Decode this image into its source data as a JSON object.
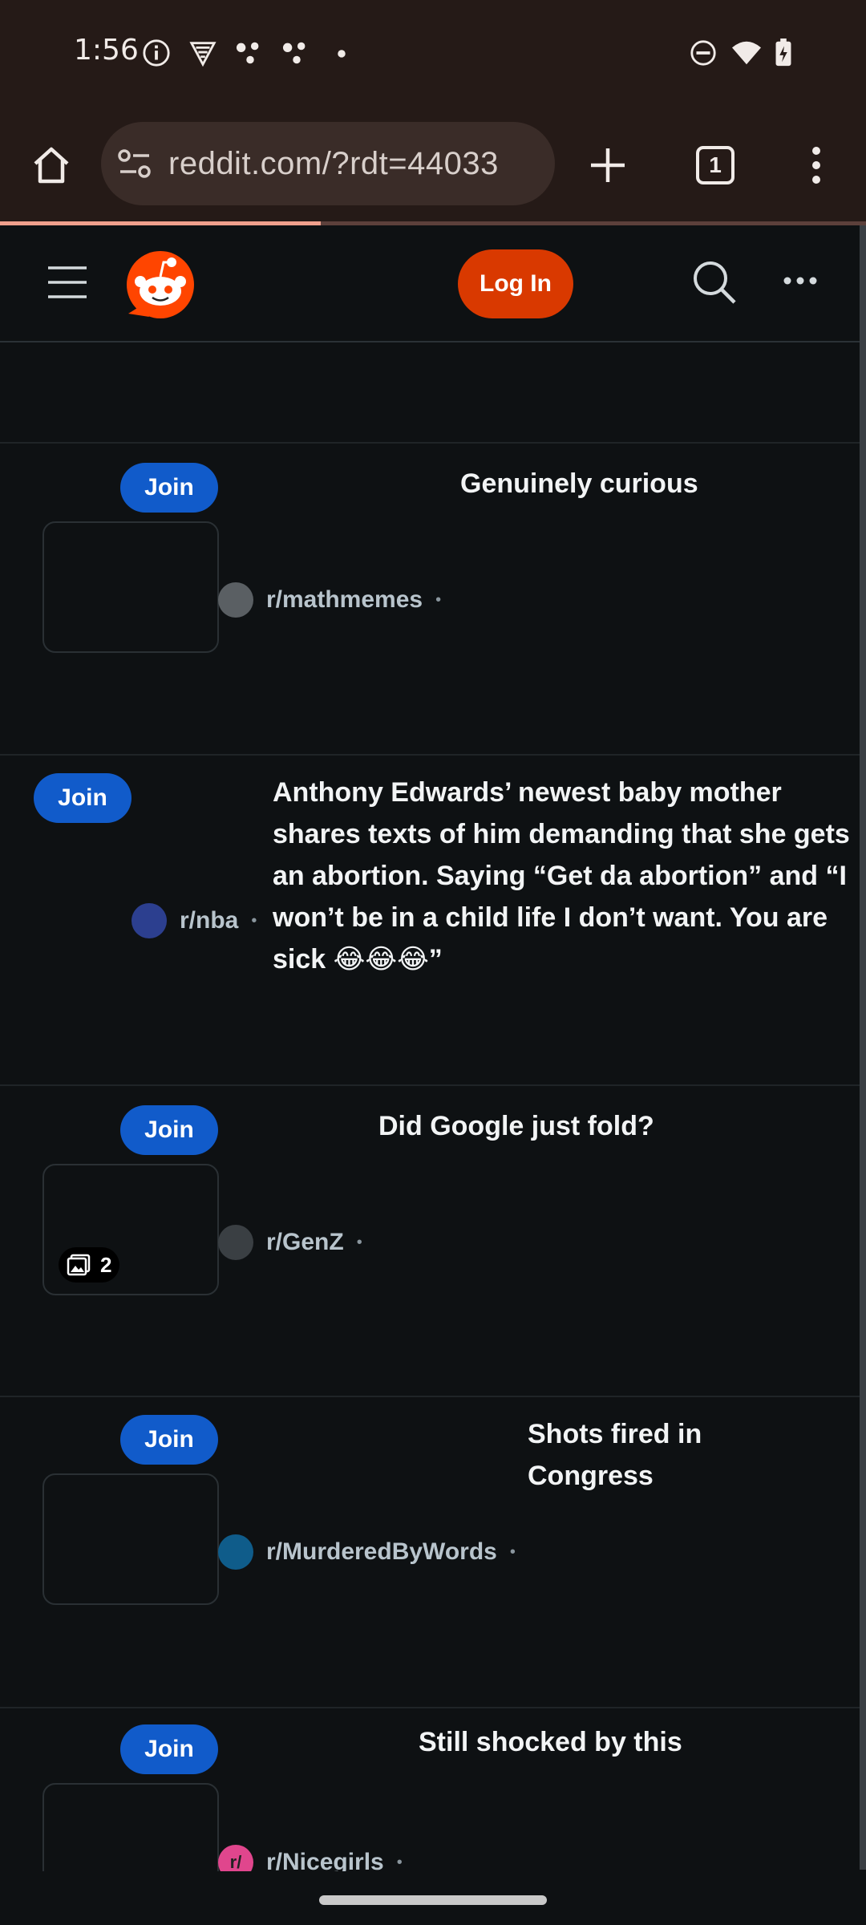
{
  "status_bar": {
    "time": "1:56"
  },
  "browser": {
    "url": "reddit.com/?rdt=44033",
    "tab_count": "1",
    "load_progress": 0.37
  },
  "header": {
    "login_label": "Log In"
  },
  "posts": [
    {
      "join_label": "Join",
      "title": "Genuinely curious",
      "subreddit": "r/mathmemes",
      "avatar_color": "#5a5f63"
    },
    {
      "join_label": "Join",
      "title": "Anthony Edwards’ newest baby mother shares texts of him demanding that she gets an abortion. Saying “Get da abortion” and “I won’t be in a child life I don’t want. You are sick 😂😂😂”",
      "subreddit": "r/nba",
      "avatar_color": "#2c3f8f"
    },
    {
      "join_label": "Join",
      "title": "Did Google just fold?",
      "subreddit": "r/GenZ",
      "avatar_color": "#3a3f43",
      "gallery_count": "2"
    },
    {
      "join_label": "Join",
      "title": "Shots fired in Congress",
      "subreddit": "r/MurderedByWords",
      "avatar_color": "#0f5c8a"
    },
    {
      "join_label": "Join",
      "title": "Still shocked by this",
      "subreddit": "r/Nicegirls",
      "avatar_color": "#e0468d",
      "avatar_text": "r/"
    }
  ]
}
